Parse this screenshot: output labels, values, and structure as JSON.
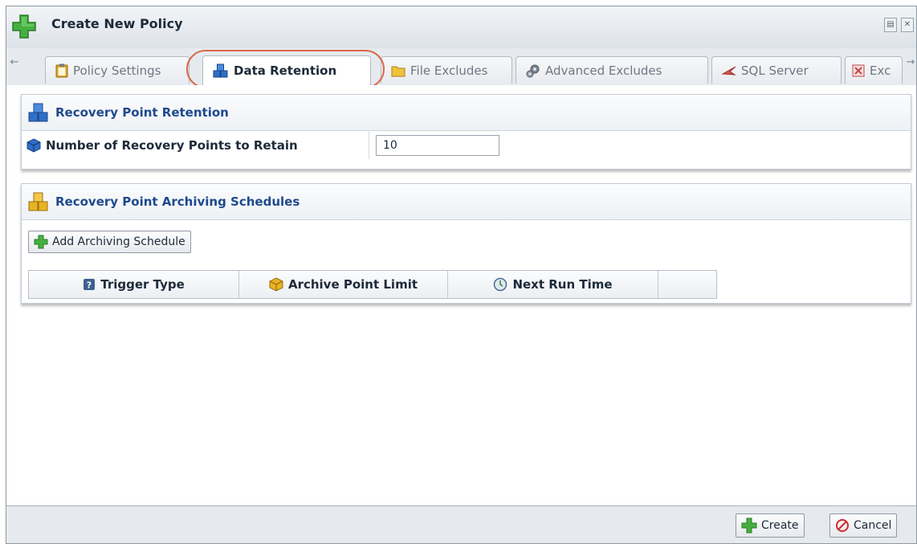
{
  "window": {
    "title": "Create New Policy"
  },
  "tabs": [
    {
      "label": "Policy Settings",
      "icon": "clipboard-icon",
      "active": false
    },
    {
      "label": "Data Retention",
      "icon": "cubes-icon",
      "active": true
    },
    {
      "label": "File Excludes",
      "icon": "folder-icon",
      "active": false
    },
    {
      "label": "Advanced Excludes",
      "icon": "gears-icon",
      "active": false
    },
    {
      "label": "SQL Server",
      "icon": "sql-server-icon",
      "active": false
    },
    {
      "label": "Exc",
      "icon": "exchange-icon",
      "active": false
    }
  ],
  "retention": {
    "title": "Recovery Point Retention",
    "field_label": "Number of Recovery Points to Retain",
    "field_value": "10"
  },
  "archiving": {
    "title": "Recovery Point Archiving Schedules",
    "add_button": "Add Archiving Schedule",
    "columns": [
      {
        "label": "Trigger Type",
        "icon": "question-icon"
      },
      {
        "label": "Archive Point Limit",
        "icon": "cube-icon"
      },
      {
        "label": "Next Run Time",
        "icon": "clock-icon"
      },
      {
        "label": "",
        "icon": ""
      }
    ]
  },
  "footer": {
    "create_label": "Create",
    "cancel_label": "Cancel"
  },
  "colors": {
    "accent_blue": "#1e4a8c",
    "highlight_ring": "#d9694a",
    "add_green": "#3aa336"
  }
}
